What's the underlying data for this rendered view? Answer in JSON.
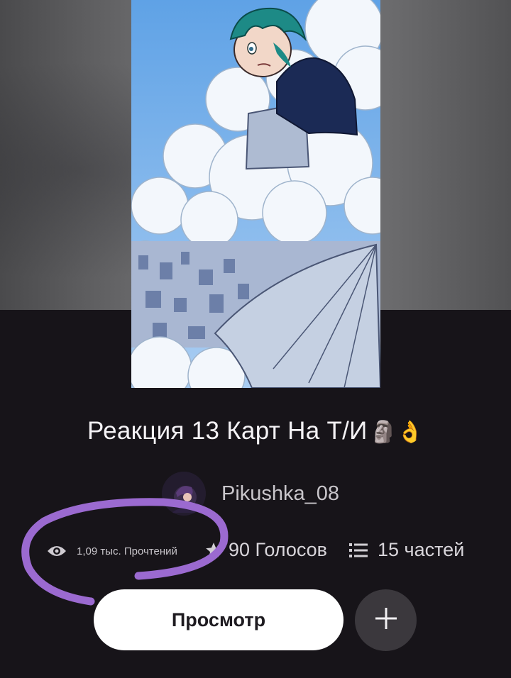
{
  "story": {
    "title": "Реакция 13 Карт На Т/И",
    "title_emojis": "🗿👌",
    "author": "Pikushka_08"
  },
  "stats": {
    "reads": "1,09 тыс. Прочтений",
    "votes": "90 Голосов",
    "parts": "15 частей"
  },
  "actions": {
    "read_label": "Просмотр",
    "add_icon": "plus-icon"
  },
  "icons": {
    "reads": "eye-icon",
    "votes": "star-icon",
    "parts": "list-icon"
  },
  "colors": {
    "background": "#171419",
    "button": "#ffffff",
    "add_button": "#3b383d",
    "annotation": "#9b6ad0"
  }
}
